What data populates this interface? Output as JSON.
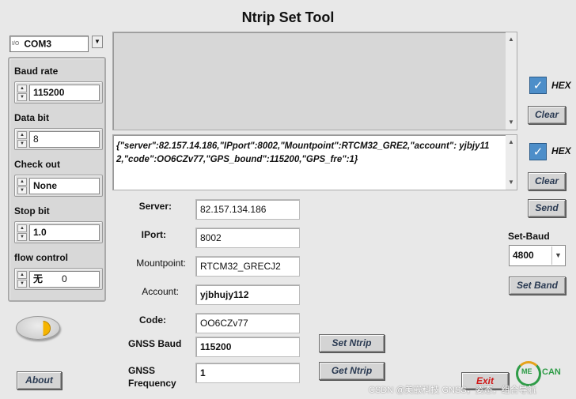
{
  "title": "Ntrip Set Tool",
  "com_port": {
    "icon_text": "I/O",
    "value": "COM3"
  },
  "settings": [
    {
      "label": "Baud rate",
      "value": "115200"
    },
    {
      "label": "Data bit",
      "value": "8"
    },
    {
      "label": "Check out",
      "value": "None"
    },
    {
      "label": "Stop bit",
      "value": "1.0"
    },
    {
      "label": "flow control",
      "value": "无",
      "extra": "0"
    }
  ],
  "send_text": "{\"server\":82.157.14.186,\"IPport\":8002,\"Mountpoint\":RTCM32_GRE2,\"account\": yjbjy112,\"code\":OO6CZv77,\"GPS_bound\":115200,\"GPS_fre\":1}",
  "hex_label": "HEX",
  "clear_label": "Clear",
  "send_label": "Send",
  "form": [
    {
      "label": "Server:",
      "value": "82.157.134.186"
    },
    {
      "label": "IPort:",
      "value": "8002"
    },
    {
      "label": "Mountpoint:",
      "value": "RTCM32_GRECJ2"
    },
    {
      "label": "Account:",
      "value": "yjbhujy112"
    },
    {
      "label": "Code:",
      "value": "OO6CZv77"
    },
    {
      "label": "GNSS Baud",
      "value": "115200"
    },
    {
      "label": "GNSS\nFrequency",
      "value": "1"
    }
  ],
  "buttons": {
    "set_ntrip": "Set  Ntrip",
    "get_ntrip": "Get  Ntrip",
    "about": "About",
    "exit": "Exit",
    "set_band": "Set Band"
  },
  "set_baud": {
    "label": "Set-Baud",
    "value": "4800"
  },
  "logo_text": "CAN",
  "logo_mark": "ME",
  "watermark": "CSDN @美嵌科技 GNSS，姿态，组合导航",
  "colors": {
    "background": "#e8e8e8",
    "check_blue": "#4d8ec9",
    "exit_red": "#d01818",
    "logo_green": "#2e9c47",
    "led_yellow": "#f5b400"
  }
}
